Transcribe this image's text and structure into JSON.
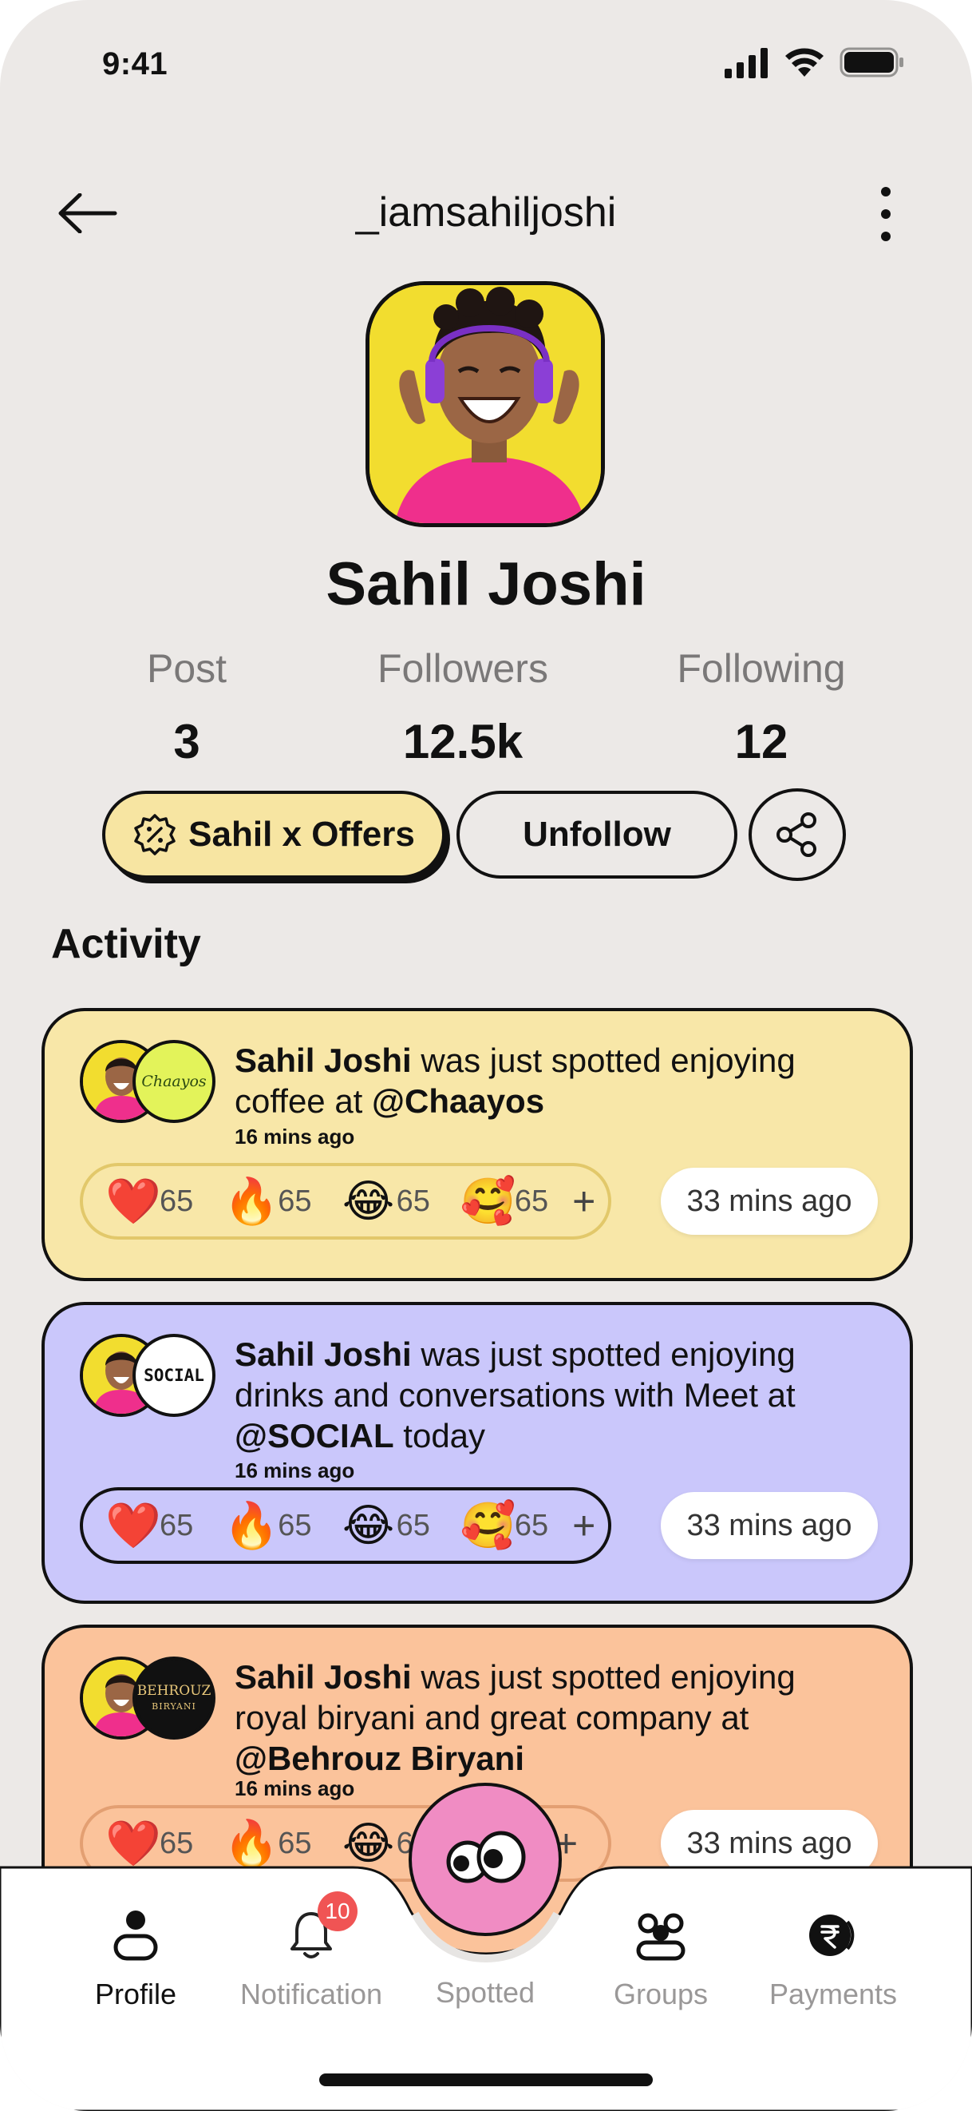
{
  "status_bar": {
    "time": "9:41"
  },
  "header": {
    "title": "_iamsahiljoshi"
  },
  "profile": {
    "name": "Sahil Joshi"
  },
  "stats": [
    {
      "label": "Post",
      "value": "3"
    },
    {
      "label": "Followers",
      "value": "12.5k"
    },
    {
      "label": "Following",
      "value": "12"
    }
  ],
  "actions": {
    "offers_label": "Sahil x Offers",
    "unfollow_label": "Unfollow"
  },
  "section_title": "Activity",
  "colors": {
    "card1": "#f8e7a8",
    "card2": "#cac7fb",
    "card3": "#fbc39b",
    "accent_pink": "#f08cc3",
    "badge_red": "#f05454"
  },
  "activity": [
    {
      "user": "Sahil Joshi",
      "text_mid": "was just spotted enjoying coffee at",
      "place": "@Chaayos",
      "text_end": "",
      "posted": "16 mins ago",
      "brand_label": "Chaayos",
      "reactions": [
        {
          "emoji": "❤️",
          "icon": "heart-icon",
          "count": "65"
        },
        {
          "emoji": "🔥",
          "icon": "fire-icon",
          "count": "65"
        },
        {
          "emoji": "😂",
          "icon": "laughing-icon",
          "count": "65"
        },
        {
          "emoji": "🥰",
          "icon": "smiling-hearts-icon",
          "count": "65"
        }
      ],
      "plus": "+",
      "time_pill": "33 mins ago"
    },
    {
      "user": "Sahil Joshi",
      "text_mid": "was just spotted enjoying drinks and conversations with Meet at",
      "place": "@SOCIAL",
      "text_end": "today",
      "posted": "16 mins ago",
      "brand_label": "SOCIAL",
      "reactions": [
        {
          "emoji": "❤️",
          "icon": "heart-icon",
          "count": "65"
        },
        {
          "emoji": "🔥",
          "icon": "fire-icon",
          "count": "65"
        },
        {
          "emoji": "😂",
          "icon": "laughing-icon",
          "count": "65"
        },
        {
          "emoji": "🥰",
          "icon": "smiling-hearts-icon",
          "count": "65"
        }
      ],
      "plus": "+",
      "time_pill": "33 mins ago"
    },
    {
      "user": "Sahil Joshi",
      "text_mid": "was just spotted enjoying royal biryani and great company at",
      "place": "@Behrouz Biryani",
      "text_end": "",
      "posted": "16 mins ago",
      "brand_label": "BEHROUZ",
      "brand_sub": "BIRYANI",
      "reactions": [
        {
          "emoji": "❤️",
          "icon": "heart-icon",
          "count": "65"
        },
        {
          "emoji": "🔥",
          "icon": "fire-icon",
          "count": "65"
        },
        {
          "emoji": "😂",
          "icon": "laughing-icon",
          "count": "65"
        }
      ],
      "plus": "+",
      "time_pill": "33 mins ago"
    }
  ],
  "nav": {
    "profile": "Profile",
    "notification": "Notification",
    "notification_badge": "10",
    "spotted": "Spotted",
    "groups": "Groups",
    "payments": "Payments"
  }
}
